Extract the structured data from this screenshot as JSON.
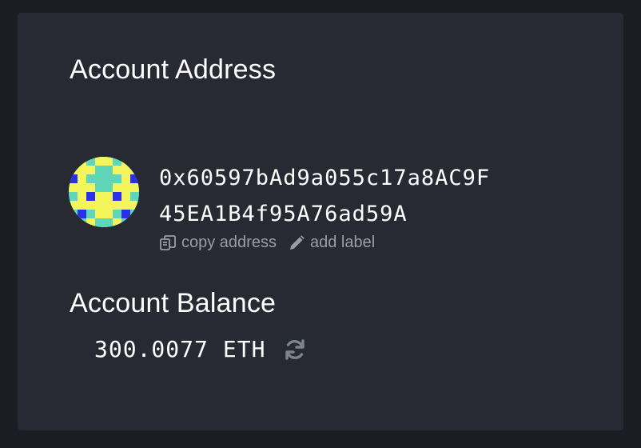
{
  "account": {
    "address_heading": "Account Address",
    "address_line1": "0x60597bAd9a055c17a8AC9F",
    "address_line2": "45EA1B4f95A76ad59A",
    "copy_label": "copy address",
    "add_label": "add label",
    "balance_heading": "Account Balance",
    "balance_value": "300.0077",
    "balance_unit": "ETH"
  },
  "icons": {
    "copy": "copy-icon",
    "edit": "pencil-icon",
    "refresh": "refresh-icon",
    "identicon": "identicon-avatar"
  },
  "colors": {
    "panel": "#272a33",
    "background": "#1b1d23",
    "text": "#ffffff",
    "muted": "#9a9da6",
    "identicon_teal": "#5fd6b8",
    "identicon_yellow": "#f3f55a",
    "identicon_blue": "#2c2fe8"
  }
}
